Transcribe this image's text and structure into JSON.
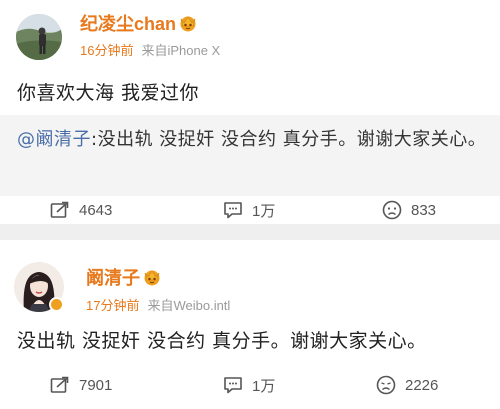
{
  "posts": [
    {
      "username": "纪凌尘chan",
      "time": "16分钟前",
      "source": "来自iPhone X",
      "text": "你喜欢大海 我爱过你",
      "repost": {
        "mention": "@阚清子",
        "text": ":没出轨 没捉奸 没合约 真分手。谢谢大家关心。"
      },
      "actions": {
        "repost": "4643",
        "comment": "1万",
        "like": "833"
      }
    },
    {
      "username": "阚清子",
      "time": "17分钟前",
      "source": "来自Weibo.intl",
      "text": "没出轨 没捉奸 没合约 真分手。谢谢大家关心。",
      "actions": {
        "repost": "7901",
        "comment": "1万",
        "like": "2226"
      }
    }
  ],
  "colors": {
    "username": "#e8791c",
    "mention": "#4a6ea8",
    "meta": "#9a9a9a",
    "verified_badge": "#f0a020"
  }
}
